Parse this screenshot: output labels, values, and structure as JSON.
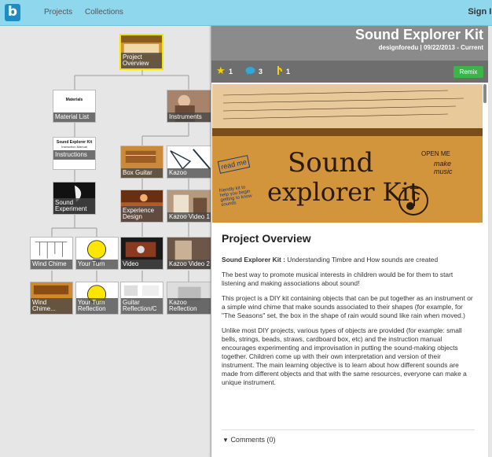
{
  "nav": {
    "logo": "b",
    "projects": "Projects",
    "collections": "Collections",
    "signin": "Sign In"
  },
  "tree": {
    "nodes": [
      {
        "label": "Project Overview",
        "selected": true
      },
      {
        "label": "Material List"
      },
      {
        "label": "Instruments"
      },
      {
        "label": "Instructions"
      },
      {
        "label": "Box Guitar"
      },
      {
        "label": "Kazoo"
      },
      {
        "label": "Sound Experiment"
      },
      {
        "label": "Experience Design"
      },
      {
        "label": "Kazoo Video 1"
      },
      {
        "label": "Wind Chime"
      },
      {
        "label": "Your Turn"
      },
      {
        "label": "Video"
      },
      {
        "label": "Kazoo Video 2"
      },
      {
        "label": "Wind Chime..."
      },
      {
        "label": "Your Turn Reflection"
      },
      {
        "label": "Guitar Reflection/C"
      },
      {
        "label": "Kazoo Reflection"
      }
    ]
  },
  "thumbs": {
    "materials": "Materials",
    "sek_title": "Sound Explorer Kit",
    "sek_sub": "Instruction Manual"
  },
  "panel": {
    "title": "Sound Explorer Kit",
    "meta": "designforedu | 09/22/2013 - Current",
    "stars": "1",
    "comments_count": "3",
    "remixes": "1",
    "remix_label": "Remix",
    "hero": {
      "line1": "Sound",
      "line2": "explorer Kit",
      "read_me": "read me",
      "open_me": "OPEN ME",
      "make": "make music",
      "friendly": "friendly kit to help you begin getting to know sounds"
    },
    "overview_title": "Project Overview",
    "p1_bold": "Sound Explorer Kit :",
    "p1_rest": " Understanding Timbre and How sounds are created",
    "p2": "The best way to promote musical interests in children would be for them to start listening and making associations about sound!",
    "p3": "This project is a DIY kit containing objects that can be put together as an instrument or a simple wind chime that make sounds associated to their shapes (for example, for \"The Seasons\" set, the box in the shape of rain would sound like rain when moved.)",
    "p4": "Unlike most DIY projects, various types of objects are provided (for example: small bells, strings, beads, straws, cardboard box, etc) and the instruction manual encourages experimenting and improvisation in putting the sound-making objects together. Children come up with their own interpretation and version of their instrument. The main learning objective is to learn about how different sounds are made from different objects and that with the same resources, everyone can make a unique instrument.",
    "comments_label": "Comments (0)"
  },
  "colors": {
    "topbar": "#8fd7ec",
    "accent": "#1e8bc3",
    "remix": "#3bb54a",
    "star": "#f5d300",
    "bubble": "#2fa8dc",
    "hero": "#c98b35"
  }
}
